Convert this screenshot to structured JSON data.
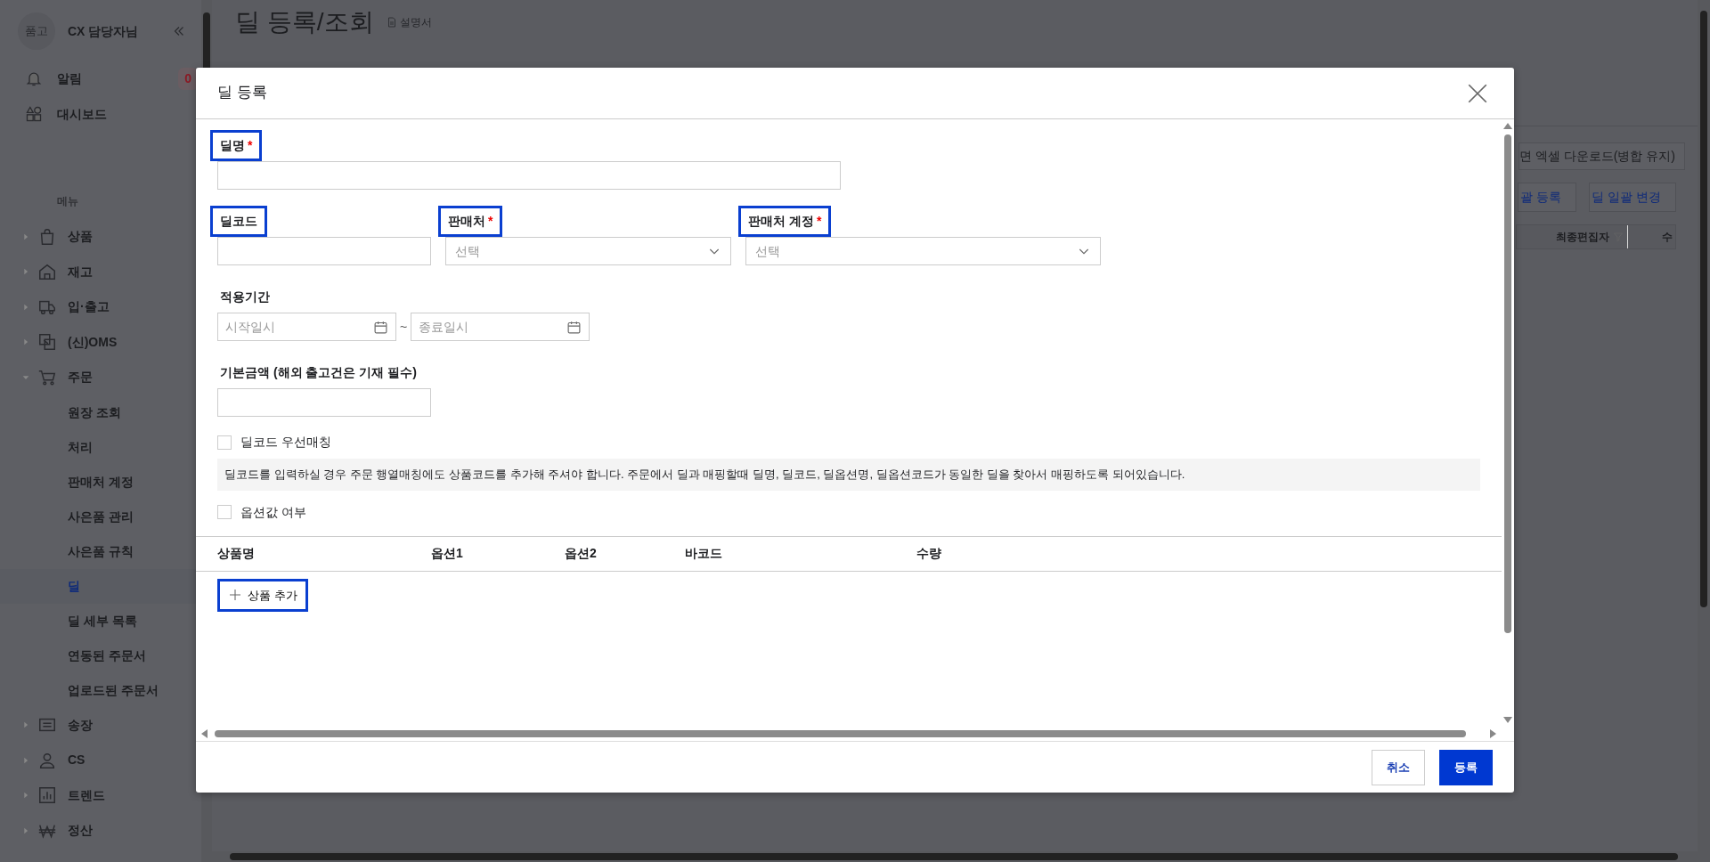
{
  "sidebar": {
    "avatar": "품고",
    "user": "CX 담당자님",
    "top_items": [
      {
        "label": "알림",
        "badge": "0"
      },
      {
        "label": "대시보드"
      }
    ],
    "section": "메뉴",
    "menu": [
      {
        "label": "상품",
        "expanded": false
      },
      {
        "label": "재고",
        "expanded": false
      },
      {
        "label": "입·출고",
        "expanded": false
      },
      {
        "label": "(신)OMS",
        "expanded": false
      },
      {
        "label": "주문",
        "expanded": true,
        "children": [
          {
            "label": "원장 조회",
            "selected": false
          },
          {
            "label": "처리",
            "selected": false
          },
          {
            "label": "판매처 계정",
            "selected": false
          },
          {
            "label": "사은품 관리",
            "selected": false
          },
          {
            "label": "사은품 규칙",
            "selected": false
          },
          {
            "label": "딜",
            "selected": true
          },
          {
            "label": "딜 세부 목록",
            "selected": false
          },
          {
            "label": "연동된 주문서",
            "selected": false
          },
          {
            "label": "업로드된 주문서",
            "selected": false
          }
        ]
      },
      {
        "label": "송장",
        "expanded": false
      },
      {
        "label": "CS",
        "expanded": false
      },
      {
        "label": "트렌드",
        "expanded": false
      },
      {
        "label": "정산",
        "expanded": false
      }
    ]
  },
  "page": {
    "title": "딜 등록/조회",
    "manual_link": "설명서",
    "buttons": [
      {
        "label": "면 엑셀 다운로드(병합 유지)",
        "kind": "outline"
      },
      {
        "label": "괄 등록",
        "kind": "outline-blue"
      },
      {
        "label": "딜 일괄 변경",
        "kind": "outline-blue"
      }
    ],
    "table_columns": [
      {
        "label": "최종편집자",
        "filter": true
      },
      {
        "label": "수",
        "filter": false
      }
    ]
  },
  "modal": {
    "title": "딜 등록",
    "field_rows": [
      [
        {
          "kind": "text",
          "label": "딜명",
          "required_mark": "*",
          "highlighted": true
        }
      ],
      [
        {
          "kind": "text",
          "label": "딜코드",
          "highlighted": true
        },
        {
          "kind": "select",
          "label": "판매처",
          "required_mark": "*",
          "highlighted": true,
          "placeholder": "선택"
        },
        {
          "kind": "select",
          "label": "판매처 계정",
          "required_mark": "*",
          "highlighted": true,
          "placeholder": "선택"
        }
      ],
      [
        {
          "kind": "daterange",
          "label": "적용기간",
          "highlighted": false,
          "start_placeholder": "시작일시",
          "separator": "~",
          "end_placeholder": "종료일시"
        }
      ],
      [
        {
          "kind": "text",
          "label": "기본금액 (해외 출고건은 기재 필수)",
          "highlighted": false
        }
      ]
    ],
    "priority_checkbox": {
      "label": "딜코드 우선매칭",
      "checked": false
    },
    "notice": "딜코드를 입력하실 경우 주문 행열매칭에도 상품코드를 추가해 주셔야 합니다. 주문에서 딜과 매핑할때 딜명, 딜코드, 딜옵션명, 딜옵션코드가 동일한 딜을 찾아서 매핑하도록 되어있습니다.",
    "option_checkbox": {
      "label": "옵션값 여부",
      "checked": false
    },
    "product_columns": [
      "상품명",
      "옵션1",
      "옵션2",
      "바코드",
      "수량"
    ],
    "add_button": {
      "label": "상품 추가",
      "highlighted": true
    },
    "footer_buttons": [
      {
        "label": "취소",
        "kind": "secondary"
      },
      {
        "label": "등록",
        "kind": "primary"
      }
    ]
  }
}
